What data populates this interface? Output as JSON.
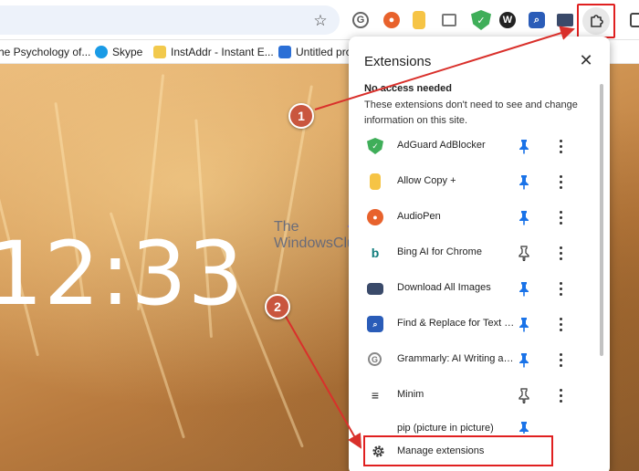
{
  "bookmarks": [
    {
      "label": "he Psychology of..."
    },
    {
      "label": "Skype"
    },
    {
      "label": "InstAddr - Instant E..."
    },
    {
      "label": "Untitled pro"
    }
  ],
  "clock": {
    "time": "12:33"
  },
  "watermark": {
    "line1": "The",
    "line2": "WindowsClub"
  },
  "popup": {
    "title": "Extensions",
    "section_heading": "No access needed",
    "section_description": "These extensions don't need to see and change information on this site.",
    "manage_label": "Manage extensions",
    "extensions": [
      {
        "name": "AdGuard AdBlocker",
        "pinned": true
      },
      {
        "name": "Allow Copy +",
        "pinned": true
      },
      {
        "name": "AudioPen",
        "pinned": true
      },
      {
        "name": "Bing AI for Chrome",
        "pinned": false
      },
      {
        "name": "Download All Images",
        "pinned": true
      },
      {
        "name": "Find & Replace for Text Editing",
        "pinned": true
      },
      {
        "name": "Grammarly: AI Writing and Grammar Checker",
        "pinned": true
      },
      {
        "name": "Minim",
        "pinned": false
      },
      {
        "name": "pip (picture in picture)",
        "pinned": true
      }
    ]
  },
  "annotations": {
    "step1": "1",
    "step2": "2"
  }
}
